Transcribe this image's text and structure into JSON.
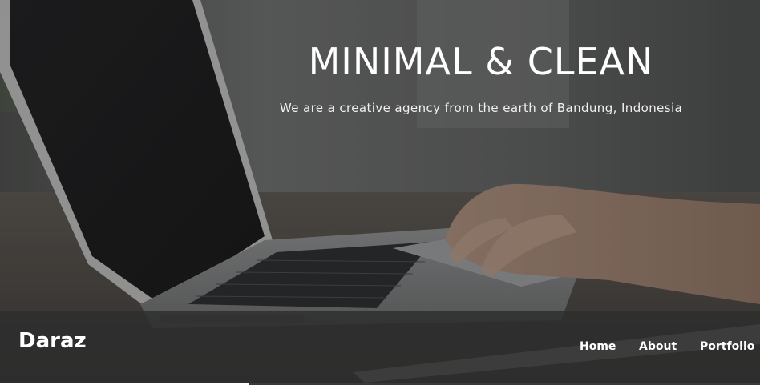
{
  "hero": {
    "title": "MINIMAL & CLEAN",
    "subtitle": "We are a creative agency from the earth of Bandung, Indonesia",
    "background": "laptop-photo"
  },
  "navbar": {
    "brand": "Daraz",
    "items": [
      {
        "label": "Home"
      },
      {
        "label": "About"
      },
      {
        "label": "Portfolio"
      }
    ]
  },
  "colors": {
    "text": "#ffffff",
    "navbar_bg": "#2d2d2d"
  }
}
